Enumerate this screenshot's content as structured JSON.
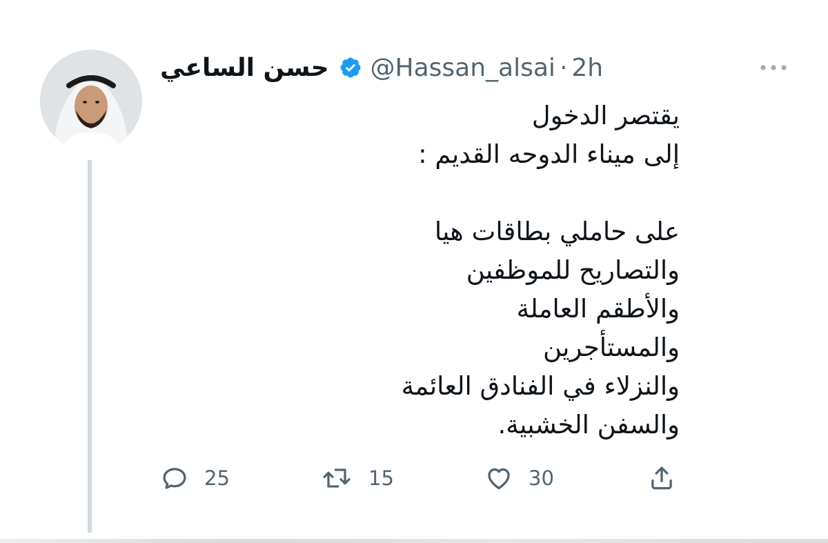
{
  "tweet": {
    "author_name": "حسن الساعي",
    "handle": "@Hassan_alsai",
    "separator": "·",
    "timestamp": "2h",
    "verified": true,
    "body_lines": [
      "يقتصر الدخول",
      "إلى ميناء الدوحه القديم :",
      "",
      "على حاملي بطاقات هيا",
      "والتصاريح للموظفين",
      "والأطقم العاملة",
      "والمستأجرين",
      "والنزلاء في الفنادق العائمة",
      "والسفن الخشبية."
    ],
    "actions": {
      "reply_count": "25",
      "retweet_count": "15",
      "like_count": "30"
    }
  },
  "icons": {
    "verified": "verified-badge-icon",
    "more": "more-dots-icon",
    "reply": "reply-bubble-icon",
    "retweet": "retweet-arrows-icon",
    "like": "heart-icon",
    "share": "share-upload-icon"
  },
  "colors": {
    "verified_blue": "#1d9bf0",
    "secondary_text": "#536471",
    "primary_text": "#0f1419",
    "thread_line": "#cfd9de"
  }
}
